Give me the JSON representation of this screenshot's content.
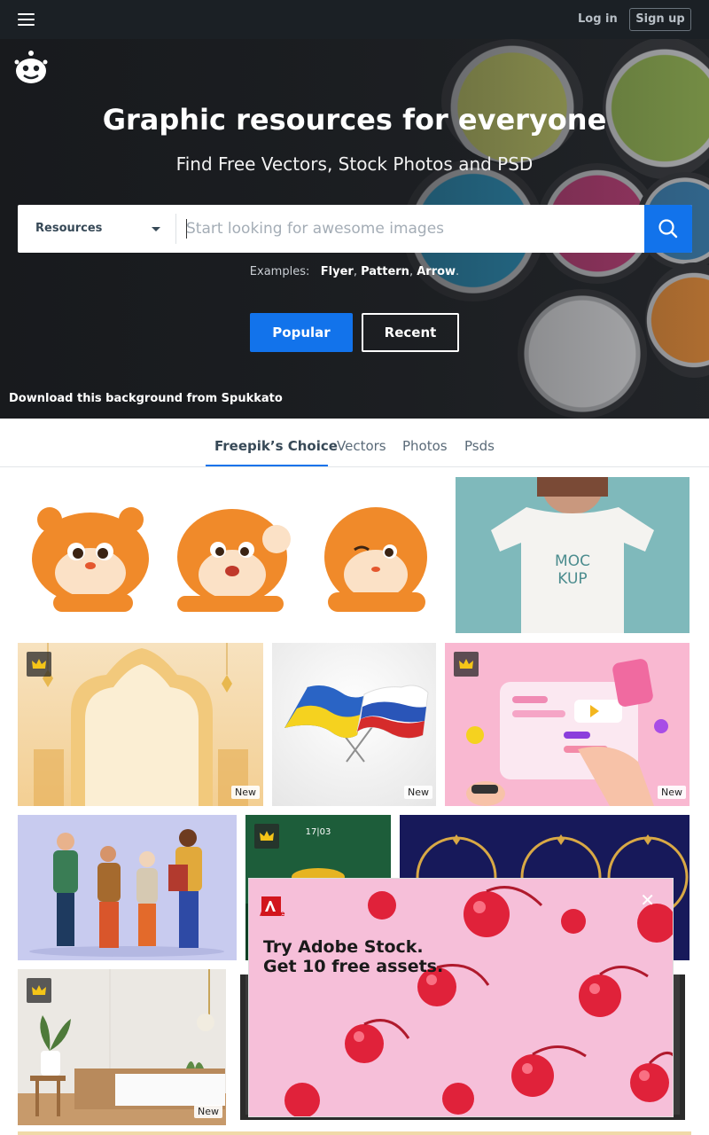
{
  "topbar": {
    "login_label": "Log in",
    "signup_label": "Sign up"
  },
  "hero": {
    "title": "Graphic resources for everyone",
    "subtitle": "Find Free Vectors, Stock Photos and PSD",
    "search": {
      "category_label": "Resources",
      "placeholder": "Start looking for awesome images"
    },
    "examples_label": "Examples:",
    "examples": [
      "Flyer",
      "Pattern",
      "Arrow"
    ],
    "popular_label": "Popular",
    "recent_label": "Recent",
    "credit_text": "Download this background from Spukkato"
  },
  "tabs": [
    "Freepik’s Choice",
    "Vectors",
    "Photos",
    "Psds"
  ],
  "mockup_text": [
    "MOC",
    "KUP"
  ],
  "new_badge": "New",
  "ad": {
    "brand": "Adobe",
    "headline_line1": "Try Adobe Stock.",
    "headline_line2": "Get 10 free assets.",
    "close_symbol": "✕"
  },
  "colors": {
    "accent": "#1273eb",
    "topbar": "#1b2025"
  }
}
